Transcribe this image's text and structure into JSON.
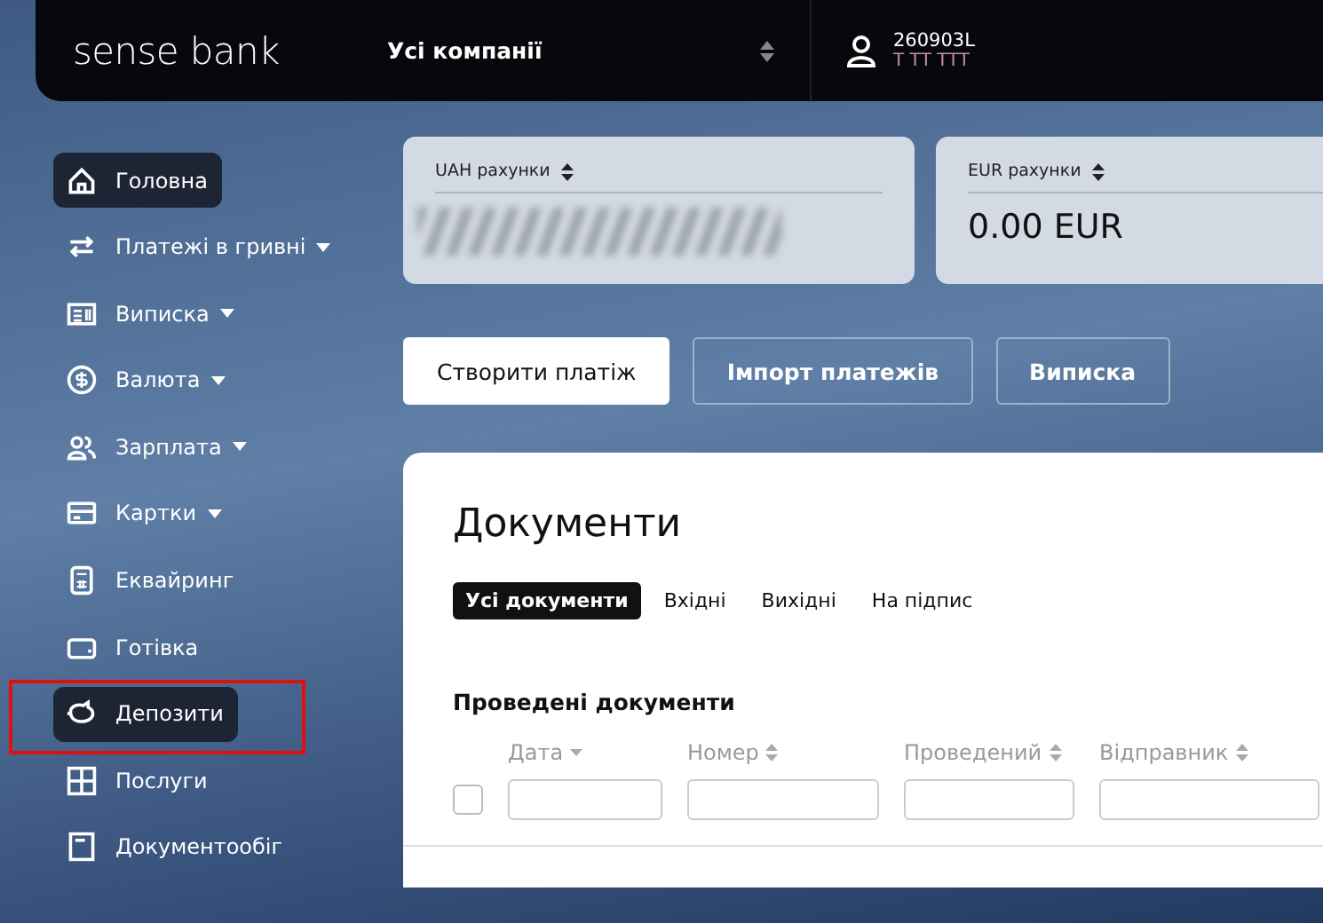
{
  "header": {
    "logo": "sense bank",
    "company_selector": {
      "value": "Усі компанії"
    },
    "user": {
      "id": "260903L",
      "name": "Т ТТ ТТТ"
    }
  },
  "sidebar": {
    "items": [
      {
        "label": "Головна",
        "selected": true,
        "has_submenu": false
      },
      {
        "label": "Платежі в гривні",
        "selected": false,
        "has_submenu": true
      },
      {
        "label": "Виписка",
        "selected": false,
        "has_submenu": true
      },
      {
        "label": "Валюта",
        "selected": false,
        "has_submenu": true
      },
      {
        "label": "Зарплата",
        "selected": false,
        "has_submenu": true
      },
      {
        "label": "Картки",
        "selected": false,
        "has_submenu": true
      },
      {
        "label": "Еквайринг",
        "selected": false,
        "has_submenu": false
      },
      {
        "label": "Готівка",
        "selected": false,
        "has_submenu": false
      },
      {
        "label": "Депозити",
        "selected": true,
        "has_submenu": false,
        "annotated": true
      },
      {
        "label": "Послуги",
        "selected": false,
        "has_submenu": false
      },
      {
        "label": "Документообіг",
        "selected": false,
        "has_submenu": false
      }
    ]
  },
  "accounts": [
    {
      "label": "UAH рахунки",
      "balance_hidden": true
    },
    {
      "label": "EUR рахунки",
      "balance_hidden": false,
      "balance": "0.00 EUR"
    }
  ],
  "actions": [
    {
      "label": "Створити платіж",
      "primary": true
    },
    {
      "label": "Імпорт платежів",
      "primary": false
    },
    {
      "label": "Виписка",
      "primary": false
    }
  ],
  "documents": {
    "title": "Документи",
    "tabs": [
      {
        "label": "Усі документи",
        "selected": true
      },
      {
        "label": "Вхідні",
        "selected": false
      },
      {
        "label": "Вихідні",
        "selected": false
      },
      {
        "label": "На підпис",
        "selected": false
      }
    ],
    "section_title": "Проведені документи",
    "select_all": {
      "checked": false
    },
    "columns": [
      {
        "label": "Дата",
        "sorted": true
      },
      {
        "label": "Номер",
        "sorted": false
      },
      {
        "label": "Проведений",
        "sorted": false
      },
      {
        "label": "Відправник",
        "sorted": false
      }
    ]
  }
}
